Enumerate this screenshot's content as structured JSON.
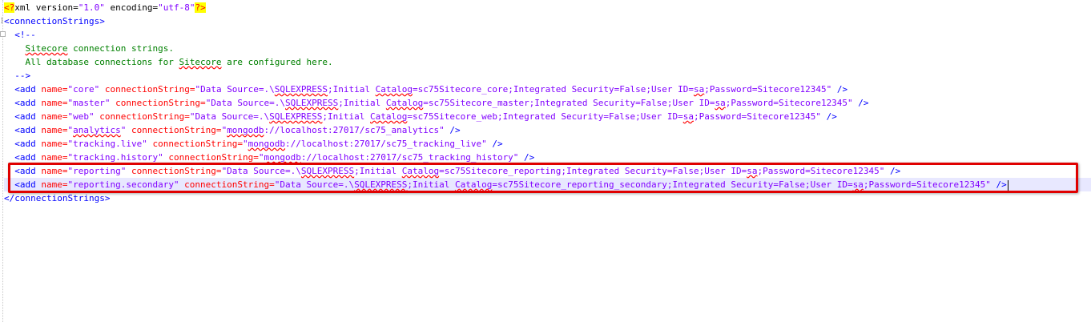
{
  "lines": [
    {
      "id": "decl",
      "parts": [
        [
          "hl",
          "<?"
        ],
        [
          "pi",
          "xml version="
        ],
        [
          "val",
          "\"1.0\""
        ],
        [
          "pi",
          " encoding="
        ],
        [
          "val",
          "\"utf-8\""
        ],
        [
          "hl",
          "?>"
        ]
      ]
    },
    {
      "id": "open",
      "parts": [
        [
          "tag",
          "<connectionStrings>"
        ]
      ]
    },
    {
      "id": "c1",
      "parts": [
        [
          "tag",
          "  <!--"
        ]
      ]
    },
    {
      "id": "c2",
      "parts": [
        [
          "cmt",
          "    "
        ],
        [
          "cmtsq",
          "Sitecore"
        ],
        [
          "cmt",
          " connection strings."
        ]
      ]
    },
    {
      "id": "c3",
      "parts": [
        [
          "cmt",
          "    All database connections for "
        ],
        [
          "cmtsq",
          "Sitecore"
        ],
        [
          "cmt",
          " are configured here."
        ]
      ]
    },
    {
      "id": "c4",
      "parts": [
        [
          "tag",
          "  -->"
        ]
      ]
    },
    {
      "id": "add-core",
      "parts": [
        [
          "tag",
          "  <add "
        ],
        [
          "attr",
          "name="
        ],
        [
          "val",
          "\"core\""
        ],
        [
          "attr",
          " connectionString="
        ],
        [
          "val",
          "\"Data Source=.\\"
        ],
        [
          "valsq",
          "SQLEXPRESS"
        ],
        [
          "val",
          ";Initial "
        ],
        [
          "valsq",
          "Catalog"
        ],
        [
          "val",
          "=sc75Sitecore_core;Integrated Security=False;User ID="
        ],
        [
          "valsq",
          "sa"
        ],
        [
          "val",
          ";Password=Sitecore12345\""
        ],
        [
          "tag",
          " />"
        ]
      ]
    },
    {
      "id": "add-master",
      "parts": [
        [
          "tag",
          "  <add "
        ],
        [
          "attr",
          "name="
        ],
        [
          "val",
          "\"master\""
        ],
        [
          "attr",
          " connectionString="
        ],
        [
          "val",
          "\"Data Source=.\\"
        ],
        [
          "valsq",
          "SQLEXPRESS"
        ],
        [
          "val",
          ";Initial "
        ],
        [
          "valsq",
          "Catalog"
        ],
        [
          "val",
          "=sc75Sitecore_master;Integrated Security=False;User ID="
        ],
        [
          "valsq",
          "sa"
        ],
        [
          "val",
          ";Password=Sitecore12345\""
        ],
        [
          "tag",
          " />"
        ]
      ]
    },
    {
      "id": "add-web",
      "parts": [
        [
          "tag",
          "  <add "
        ],
        [
          "attr",
          "name="
        ],
        [
          "val",
          "\"web\""
        ],
        [
          "attr",
          " connectionString="
        ],
        [
          "val",
          "\"Data Source=.\\"
        ],
        [
          "valsq",
          "SQLEXPRESS"
        ],
        [
          "val",
          ";Initial "
        ],
        [
          "valsq",
          "Catalog"
        ],
        [
          "val",
          "=sc75Sitecore_web;Integrated Security=False;User ID="
        ],
        [
          "valsq",
          "sa"
        ],
        [
          "val",
          ";Password=Sitecore12345\""
        ],
        [
          "tag",
          " />"
        ]
      ]
    },
    {
      "id": "add-analytics",
      "parts": [
        [
          "tag",
          "  <add "
        ],
        [
          "attr",
          "name="
        ],
        [
          "val",
          "\""
        ],
        [
          "valsq",
          "analytics"
        ],
        [
          "val",
          "\""
        ],
        [
          "attr",
          " connectionString="
        ],
        [
          "val",
          "\""
        ],
        [
          "valsq",
          "mongodb"
        ],
        [
          "val",
          "://localhost:27017/sc75_analytics\""
        ],
        [
          "tag",
          " />"
        ]
      ]
    },
    {
      "id": "add-tracking-live",
      "parts": [
        [
          "tag",
          "  <add "
        ],
        [
          "attr",
          "name="
        ],
        [
          "val",
          "\"tracking.live\""
        ],
        [
          "attr",
          " connectionString="
        ],
        [
          "val",
          "\""
        ],
        [
          "valsq",
          "mongodb"
        ],
        [
          "val",
          "://localhost:27017/sc75_tracking_live\""
        ],
        [
          "tag",
          " />"
        ]
      ]
    },
    {
      "id": "add-tracking-history",
      "parts": [
        [
          "tag",
          "  <add "
        ],
        [
          "attr",
          "name="
        ],
        [
          "val",
          "\"tracking.history\""
        ],
        [
          "attr",
          " connectionString="
        ],
        [
          "val",
          "\""
        ],
        [
          "valsq",
          "mongodb"
        ],
        [
          "val",
          "://localhost:27017/sc75_tracking_history\""
        ],
        [
          "tag",
          " />"
        ]
      ]
    },
    {
      "id": "add-reporting",
      "parts": [
        [
          "tag",
          "  <add "
        ],
        [
          "attr",
          "name="
        ],
        [
          "val",
          "\"reporting\""
        ],
        [
          "attr",
          " connectionString="
        ],
        [
          "val",
          "\"Data Source=.\\"
        ],
        [
          "valsq",
          "SQLEXPRESS"
        ],
        [
          "val",
          ";Initial "
        ],
        [
          "valsq",
          "Catalog"
        ],
        [
          "val",
          "=sc75Sitecore_reporting;Integrated Security=False;User ID="
        ],
        [
          "valsq",
          "sa"
        ],
        [
          "val",
          ";Password=Sitecore12345\""
        ],
        [
          "tag",
          " />"
        ]
      ]
    },
    {
      "id": "add-reporting-secondary",
      "current": true,
      "parts": [
        [
          "tag",
          "  <add "
        ],
        [
          "attr",
          "name="
        ],
        [
          "val",
          "\"reporting.secondary\""
        ],
        [
          "attr",
          " connectionString="
        ],
        [
          "val",
          "\"Data Source=.\\"
        ],
        [
          "valsq",
          "SQLEXPRESS"
        ],
        [
          "val",
          ";Initial "
        ],
        [
          "valsq",
          "Catalog"
        ],
        [
          "val",
          "=sc75Sitecore_reporting_secondary;Integrated Security=False;User ID="
        ],
        [
          "valsq",
          "sa"
        ],
        [
          "val",
          ";Password=Sitecore12345\""
        ],
        [
          "tag",
          " />"
        ]
      ]
    },
    {
      "id": "close",
      "parts": [
        [
          "tag",
          "</connectionStrings>"
        ]
      ]
    }
  ],
  "colors": {
    "highlight_box": "#e00000",
    "tag": "#0000ff",
    "attribute": "#ff0000",
    "value": "#8000ff",
    "comment": "#008000"
  }
}
